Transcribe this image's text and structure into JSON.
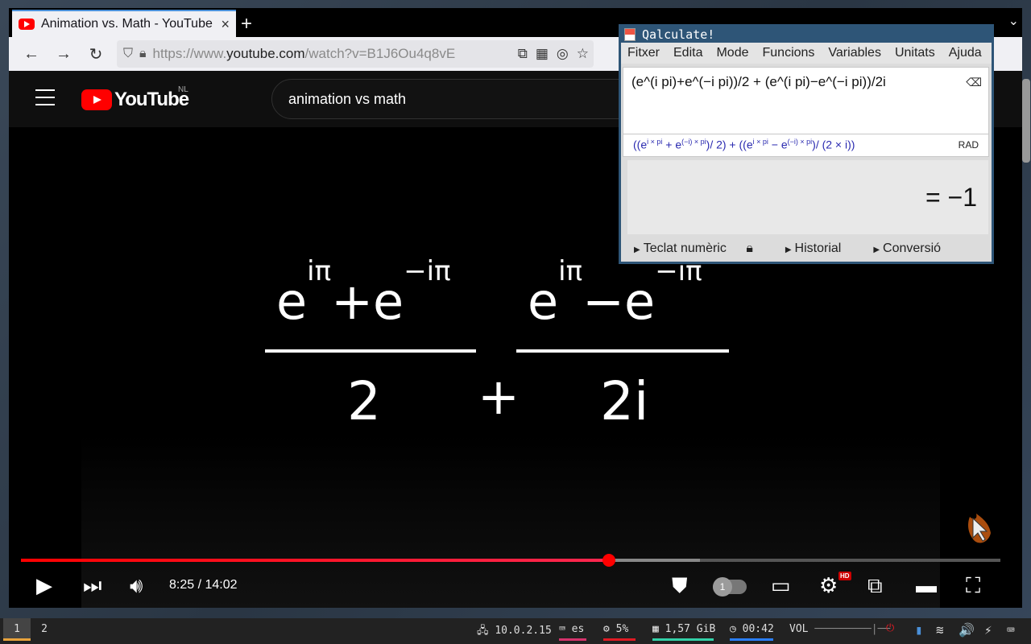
{
  "browser": {
    "tab_title": "Animation vs. Math - YouTube",
    "tab_close": "×",
    "new_tab": "+",
    "tab_list": "⌄",
    "url_prefix": "https://www.",
    "url_host": "youtube.com",
    "url_path": "/watch?v=B1J6Ou4q8vE"
  },
  "youtube": {
    "logo_text": "YouTube",
    "country": "NL",
    "search_value": "animation vs math"
  },
  "video": {
    "equation": {
      "num1": "e^iπ + e^−iπ",
      "den1": "2",
      "plus": "+",
      "num2": "e^iπ − e^−iπ",
      "den2": "2i",
      "e": "e",
      "exp_pos": "iπ",
      "exp_neg": "−iπ",
      "op_plus": "+",
      "op_minus": "−"
    },
    "time": "8:25 / 14:02",
    "progress_played": 0.6,
    "progress_loaded": 0.693,
    "speed_badge": "1",
    "hd_badge": "HD"
  },
  "qalculate": {
    "title": "Qalculate!",
    "menu": [
      "Fitxer",
      "Edita",
      "Mode",
      "Funcions",
      "Variables",
      "Unitats",
      "Ajuda"
    ],
    "input": "(e^(i pi)+e^(−i pi))/2 + (e^(i pi)−e^(−i pi))/2i",
    "parsed": "((e^(i × pi) + e^((−i) × pi)) / 2) + ((e^(i × pi) − e^((−i) × pi)) / (2 × i))",
    "parsed_display": {
      "p1": "((e",
      "s1": "i × pi",
      "p2": " + e",
      "s2": "(−i) × pi",
      "p3": ")/ 2) + ((e",
      "s3": "i × pi",
      "p4": " − e",
      "s4": "(−i) × pi",
      "p5": ")/ (2 × i))"
    },
    "angle_mode": "RAD",
    "result": "= −1",
    "footer": [
      "Teclat numèric",
      "Historial",
      "Conversió"
    ]
  },
  "taskbar": {
    "workspaces": [
      "1",
      "2"
    ],
    "ip": "10.0.2.15",
    "keyboard": "es",
    "cpu": "5%",
    "memory": "1,57 GiB",
    "clock": "00:42",
    "volume_label": "VOL",
    "ip_icon": "🖧",
    "kbd_icon": "⌨",
    "cpu_icon": "⚙",
    "mem_icon": "▦",
    "clock_icon": "◷",
    "vol_bar": "─────────|──",
    "power_icon": "⏻",
    "usb_icon": "▮",
    "wifi_icon": "≋",
    "speaker_icon": "🔊",
    "battery_icon": "⚡",
    "kbdtray_icon": "⌨"
  },
  "colors": {
    "accent_red": "#ff0000",
    "qalc_title_bg": "#2e5577",
    "parsed_text": "#2a2ab0"
  }
}
